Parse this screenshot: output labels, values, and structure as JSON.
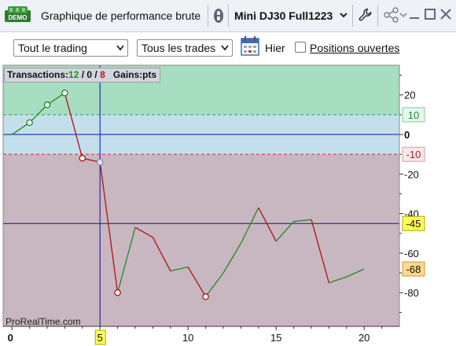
{
  "window": {
    "badge": "DEMO",
    "title": "Graphique de performance brute",
    "instrument": "Mini DJ30 Full1223"
  },
  "controls": {
    "scope_select": "Tout le trading",
    "trades_select": "Tous les trades",
    "date_label": "Hier",
    "open_positions_label": "Positions ouvertes",
    "open_positions_checked": false
  },
  "info": {
    "label": "Transactions",
    "winners": "12",
    "neutral": "0",
    "losers": "8",
    "gains_label": "Gains",
    "gains_unit": "pts"
  },
  "watermark": "ProRealTime.com",
  "cursor_x_label": "5",
  "colors": {
    "zone_positive": "#a7ddc0",
    "zone_neutral": "#c4dfec",
    "zone_negative": "#c8b7c0",
    "up": "#1d8a1d",
    "down": "#b01010",
    "cursor": "#1010a0",
    "highlight": "#ffff55"
  },
  "chart_data": {
    "type": "line",
    "title": "",
    "xlabel": "",
    "ylabel": "",
    "x": [
      0,
      1,
      2,
      3,
      4,
      5,
      6,
      7,
      8,
      9,
      10,
      11,
      12,
      13,
      14,
      15,
      16,
      17,
      18,
      19,
      20
    ],
    "y": [
      0,
      6,
      15,
      21,
      -12,
      -14,
      -80,
      -47,
      -52,
      -69,
      -67,
      -82,
      -70,
      -55,
      -37,
      -54,
      -44,
      -43,
      -75,
      -72,
      -68
    ],
    "markers_at": [
      1,
      2,
      3,
      4,
      5,
      6,
      11
    ],
    "xlim": [
      -0.5,
      22
    ],
    "ylim": [
      -97,
      35
    ],
    "x_ticks": [
      0,
      5,
      10,
      15,
      20
    ],
    "y_ticks": [
      20,
      0,
      -20,
      -40,
      -60,
      -80
    ],
    "x_tick_labels": [
      "0",
      "5",
      "10",
      "15",
      "20"
    ],
    "y_tick_labels": [
      "20",
      "0",
      "-20",
      "-40",
      "-60",
      "-80"
    ],
    "levels": [
      {
        "value": 10,
        "label": "10"
      },
      {
        "value": -10,
        "label": "-10"
      },
      {
        "value": -45,
        "label": "-45"
      },
      {
        "value": -68,
        "label": "-68"
      }
    ],
    "cursor_x": 5,
    "horizontal_lines": [
      0,
      -45
    ],
    "zones": {
      "top_above": 10,
      "bottom_below": -10
    }
  }
}
